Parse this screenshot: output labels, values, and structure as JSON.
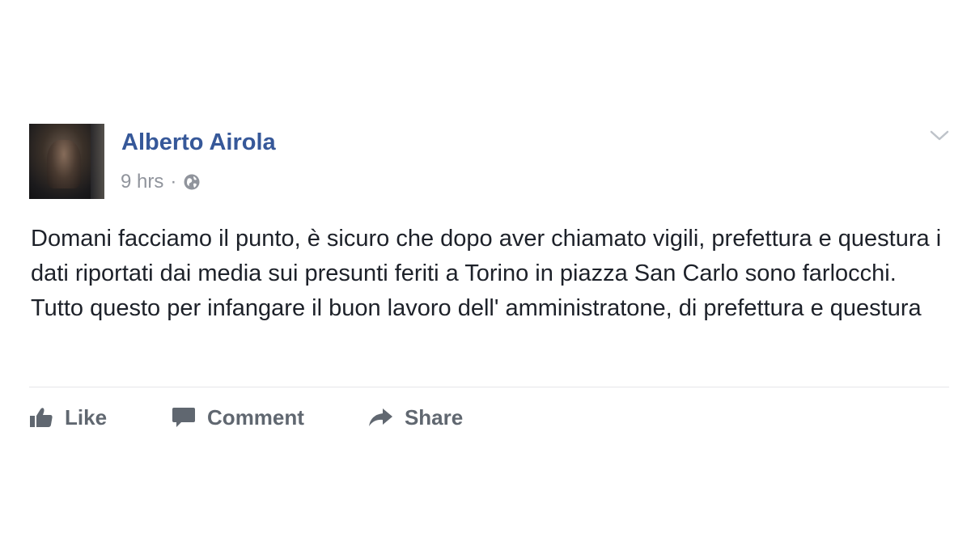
{
  "post": {
    "author": "Alberto Airola",
    "timestamp": "9 hrs",
    "separator": "·",
    "audience_icon": "globe-icon",
    "menu_icon": "chevron-down-icon",
    "text": "Domani facciamo il punto, è sicuro che dopo aver chiamato vigili, prefettura e questura i dati riportati dai media sui presunti feriti a Torino in piazza San Carlo sono farlocchi. Tutto questo per infangare il buon lavoro dell' amministratone, di prefettura e questura"
  },
  "actions": {
    "like": {
      "label": "Like",
      "icon": "thumbs-up-icon"
    },
    "comment": {
      "label": "Comment",
      "icon": "comment-bubble-icon"
    },
    "share": {
      "label": "Share",
      "icon": "share-arrow-icon"
    }
  },
  "colors": {
    "author_link": "#365899",
    "meta_text": "#90949c",
    "body_text": "#1d2129",
    "action_text": "#606770",
    "divider": "#e5e6e9"
  }
}
